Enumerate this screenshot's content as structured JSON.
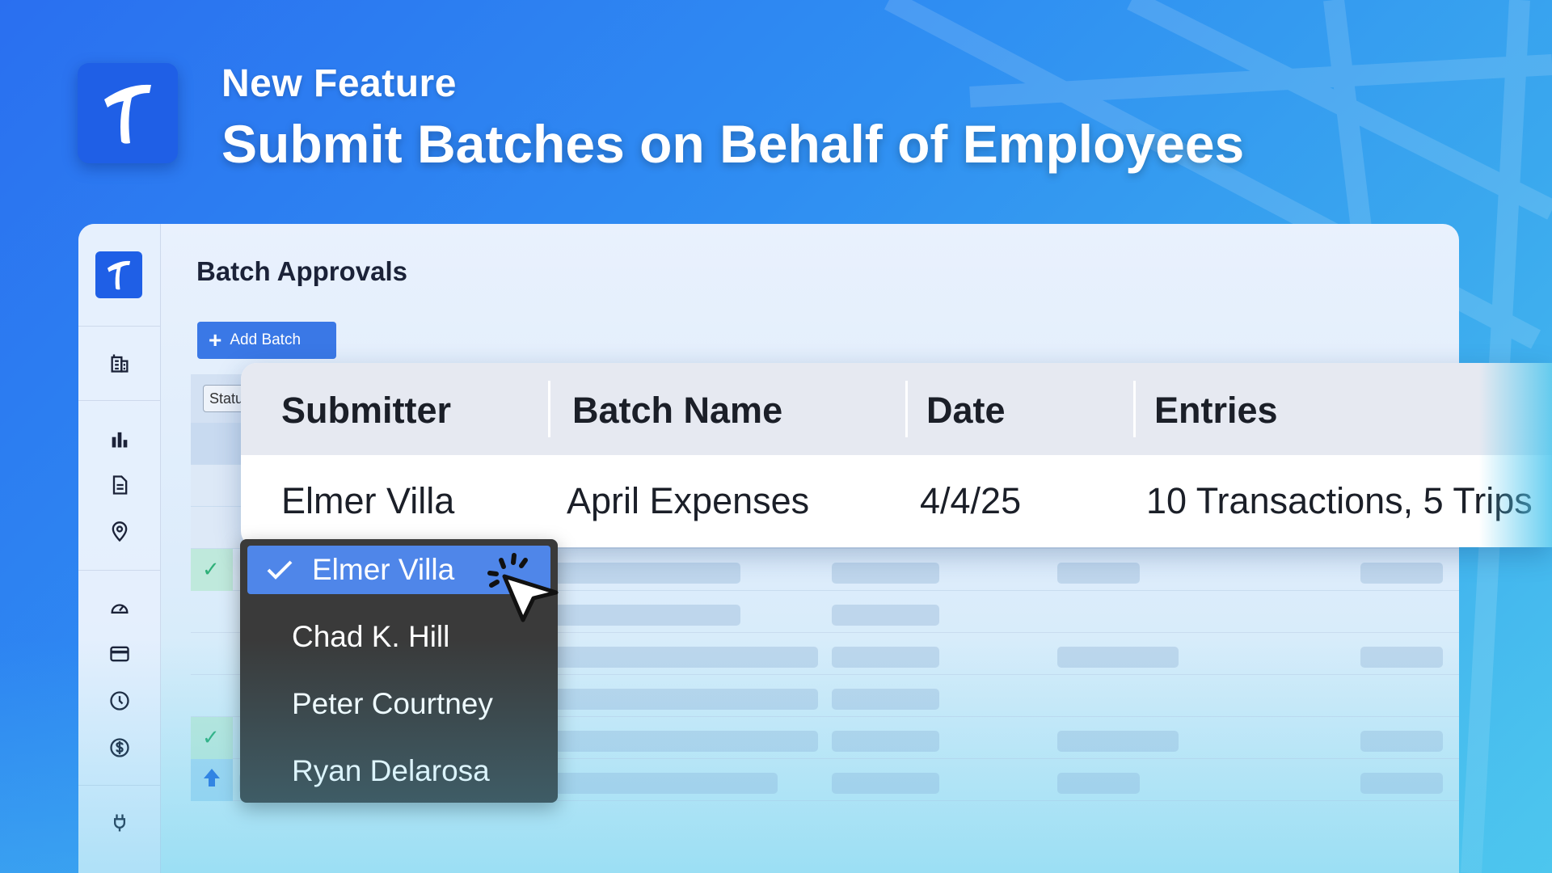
{
  "banner": {
    "eyebrow": "New Feature",
    "headline": "Submit Batches on Behalf of Employees",
    "logo_icon": "brand-t-logo"
  },
  "app": {
    "page_title": "Batch Approvals",
    "add_batch_label": "Add Batch",
    "status_chip_label": "Statu",
    "sidebar_icons": [
      "building-icon",
      "bar-chart-icon",
      "document-icon",
      "location-pin-icon",
      "speedometer-icon",
      "credit-card-icon",
      "clock-icon",
      "dollar-icon",
      "plug-icon"
    ]
  },
  "card": {
    "headers": [
      "Submitter",
      "Batch Name",
      "Date",
      "Entries"
    ],
    "row": {
      "submitter": "Elmer Villa",
      "batch_name": "April Expenses",
      "date": "4/4/25",
      "entries": "10 Transactions, 5 Trips"
    }
  },
  "dropdown": {
    "selected": "Elmer Villa",
    "options": [
      "Elmer Villa",
      "Chad K. Hill",
      "Peter Courtney",
      "Ryan Delarosa"
    ]
  },
  "colors": {
    "accent": "#1f5fe6",
    "selected_option": "#4f86e9",
    "dropdown_bg": "#3a3a3a",
    "check_green": "#2fb079"
  }
}
